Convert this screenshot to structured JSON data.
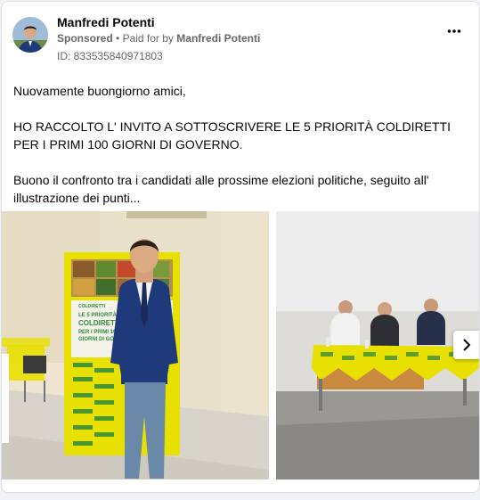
{
  "post": {
    "author_name": "Manfredi Potenti",
    "sponsored_label": "Sponsored",
    "separator": "•",
    "paid_for_prefix": "Paid for by",
    "paid_for_name": "Manfredi Potenti",
    "ad_id": "ID: 833535840971803",
    "more_icon": "more-horizontal-icon",
    "text": {
      "line1": "Nuovamente buongiorno amici,",
      "line2": "HO RACCOLTO L' INVITO A SOTTOSCRIVERE LE 5 PRIORITÀ COLDIRETTI PER I PRIMI 100 GIORNI DI GOVERNO.",
      "line3": "Buono il confronto tra i candidati alle prossime elezioni politiche, seguito all' illustrazione dei punti..."
    },
    "banner_text": {
      "brand": "COLDIRETTI",
      "line1": "LE 5 PRIORITÀ",
      "line2": "COLDIRETTI",
      "line3": "PER I PRIMI 100",
      "line4": "GIORNI DI GOVERNO"
    },
    "carousel": {
      "next_icon": "chevron-right-icon"
    }
  },
  "colors": {
    "name": "#050505",
    "meta": "#65676b",
    "coldiretti_yellow": "#e8e000",
    "coldiretti_green": "#2e8b3a"
  }
}
